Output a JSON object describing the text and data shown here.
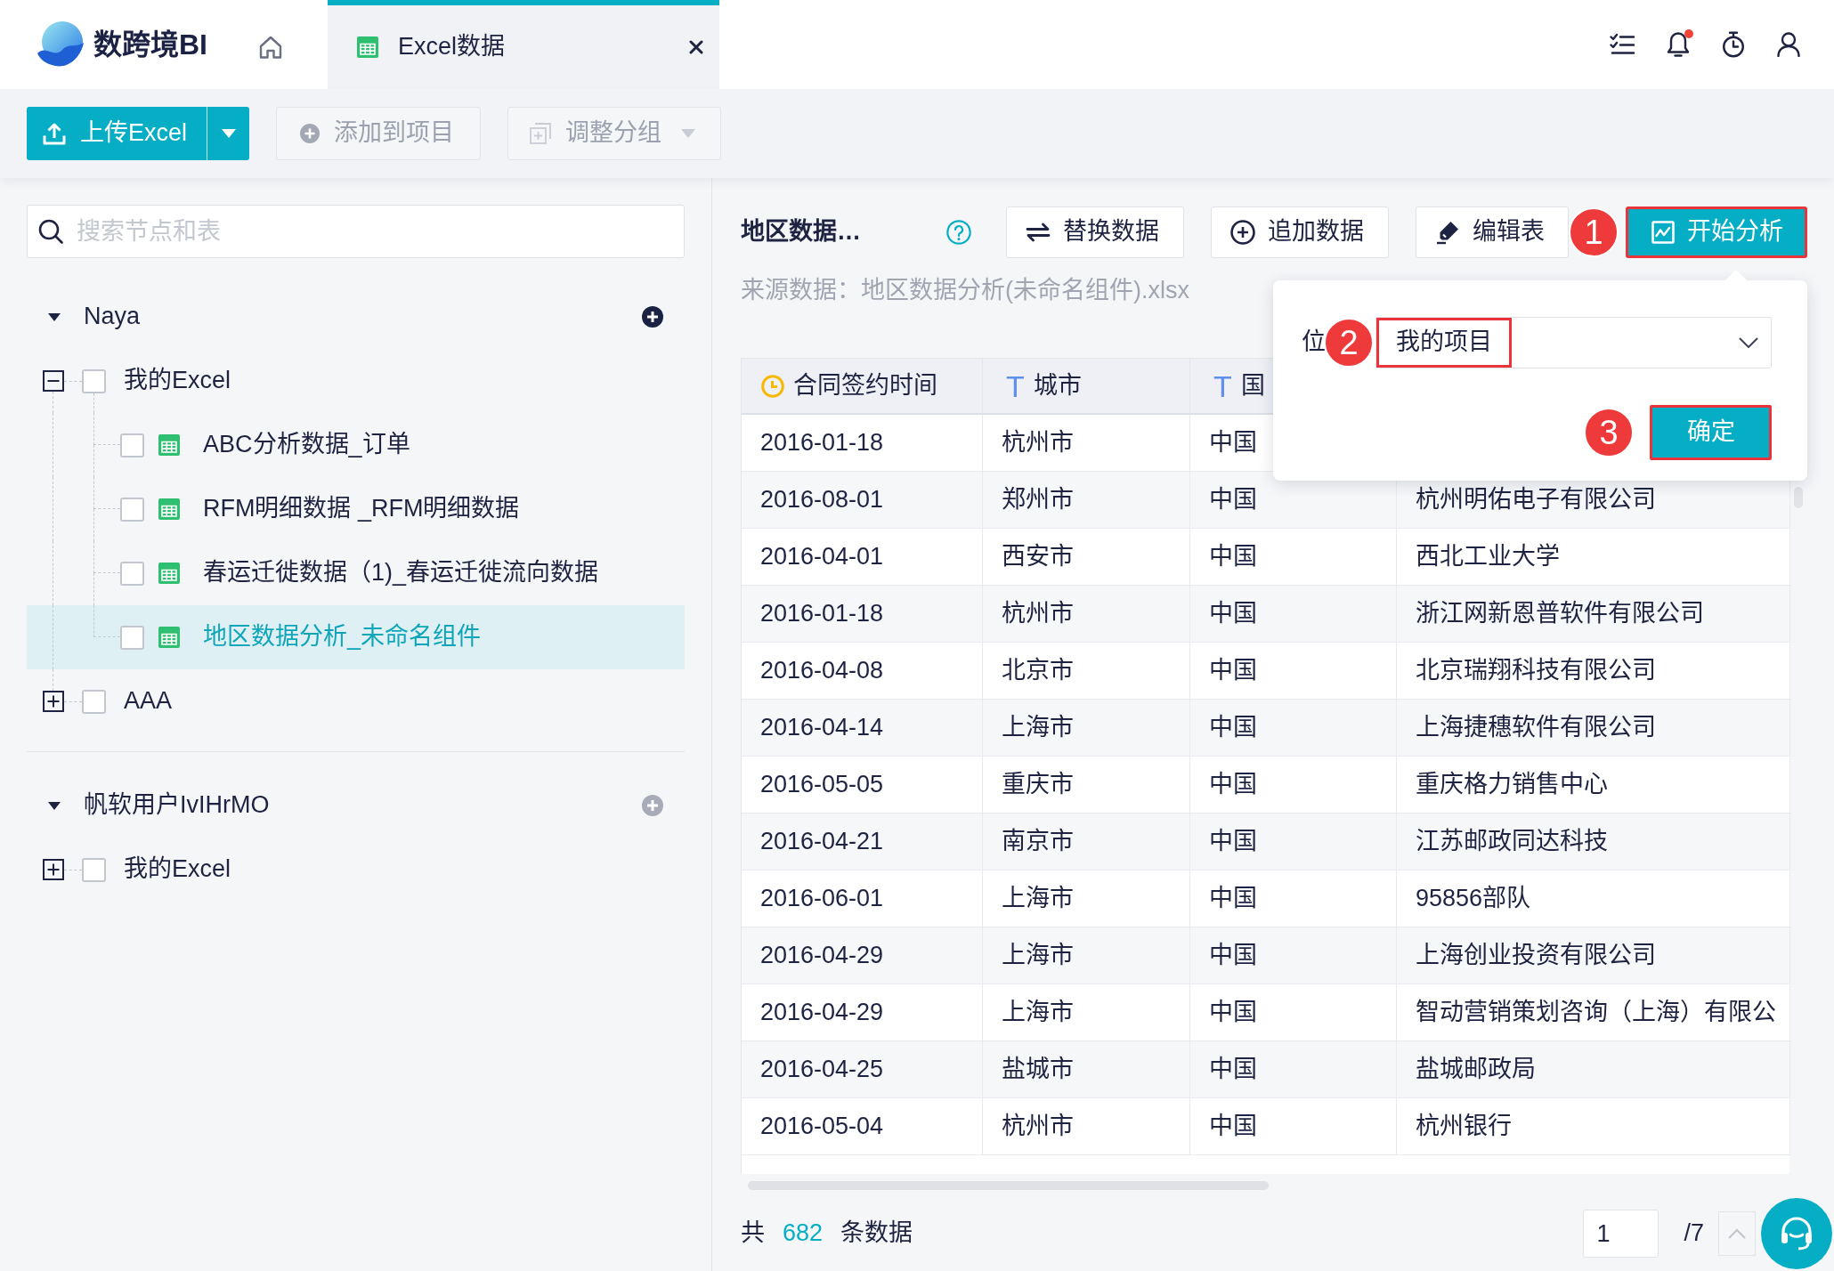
{
  "brand": {
    "name": "数跨境BI"
  },
  "tabs": [
    {
      "kind": "home",
      "selected": false
    },
    {
      "kind": "sheet",
      "label": "Excel数据",
      "selected": true,
      "closable": true
    }
  ],
  "header_icons": [
    {
      "kind": "tasks"
    },
    {
      "kind": "bell",
      "unread": true
    },
    {
      "kind": "timer"
    },
    {
      "kind": "user"
    }
  ],
  "toolbar": [
    {
      "kind": "upload",
      "label": "上传Excel",
      "disabled": false,
      "split": true
    },
    {
      "kind": "add",
      "label": "添加到项目",
      "disabled": true
    },
    {
      "kind": "group",
      "label": "调整分组",
      "disabled": true,
      "dropdown": true
    }
  ],
  "sidebar": {
    "search": {
      "placeholder": "搜索节点和表"
    },
    "tree": [
      {
        "label": "Naya",
        "expanded": true,
        "add_disabled": false,
        "children": [
          {
            "label": "我的Excel",
            "expanded": true,
            "checked": false,
            "children": [
              {
                "label": "ABC分析数据_订单",
                "checked": false,
                "selected": false
              },
              {
                "label": "RFM明细数据 _RFM明细数据",
                "checked": false,
                "selected": false
              },
              {
                "label": "春运迁徙数据（1)_春运迁徙流向数据",
                "checked": false,
                "selected": false
              },
              {
                "label": "地区数据分析_未命名组件",
                "checked": false,
                "selected": true
              }
            ]
          },
          {
            "label": "AAA",
            "expanded": false,
            "checked": false
          }
        ]
      },
      {
        "label": "帆软用户IvIHrMO",
        "expanded": true,
        "add_disabled": true,
        "children": [
          {
            "label": "我的Excel",
            "expanded": false,
            "checked": false
          }
        ]
      }
    ]
  },
  "detail": {
    "title": "地区数据…",
    "actions": [
      {
        "kind": "replace",
        "label": "替换数据",
        "primary": false,
        "highlighted": false
      },
      {
        "kind": "append",
        "label": "追加数据",
        "primary": false,
        "highlighted": false
      },
      {
        "kind": "edit",
        "label": "编辑表",
        "primary": false,
        "highlighted": false
      },
      {
        "kind": "analyze",
        "label": "开始分析",
        "primary": true,
        "highlighted": true,
        "marker": "1"
      }
    ],
    "source": "来源数据：地区数据分析(未命名组件).xlsx"
  },
  "popover": {
    "label": "位",
    "select": {
      "value": "我的项目",
      "highlighted": true,
      "marker": "2"
    },
    "confirm": {
      "label": "确定",
      "highlighted": true,
      "marker": "3"
    }
  },
  "table": {
    "columns": [
      {
        "kind": "date",
        "label": "合同签约时间"
      },
      {
        "kind": "text",
        "glyph": "T",
        "label": "城市"
      },
      {
        "kind": "text",
        "glyph": "T",
        "label": "国"
      }
    ],
    "rows": [
      [
        "2016-01-18",
        "杭州市",
        "中国"
      ],
      [
        "2016-08-01",
        "郑州市",
        "中国",
        "杭州明佑电子有限公司"
      ],
      [
        "2016-04-01",
        "西安市",
        "中国",
        "西北工业大学"
      ],
      [
        "2016-01-18",
        "杭州市",
        "中国",
        "浙江网新恩普软件有限公司"
      ],
      [
        "2016-04-08",
        "北京市",
        "中国",
        "北京瑞翔科技有限公司"
      ],
      [
        "2016-04-14",
        "上海市",
        "中国",
        "上海捷穗软件有限公司"
      ],
      [
        "2016-05-05",
        "重庆市",
        "中国",
        "重庆格力销售中心"
      ],
      [
        "2016-04-21",
        "南京市",
        "中国",
        "江苏邮政同达科技"
      ],
      [
        "2016-06-01",
        "上海市",
        "中国",
        "95856部队"
      ],
      [
        "2016-04-29",
        "上海市",
        "中国",
        "上海创业投资有限公司"
      ],
      [
        "2016-04-29",
        "上海市",
        "中国",
        "智动营销策划咨询（上海）有限公"
      ],
      [
        "2016-04-25",
        "盐城市",
        "中国",
        "盐城邮政局"
      ],
      [
        "2016-05-04",
        "杭州市",
        "中国",
        "杭州银行"
      ]
    ]
  },
  "footer": {
    "prefix": "共",
    "count": "682",
    "suffix": "条数据",
    "page": "1",
    "page_total": "/7"
  }
}
